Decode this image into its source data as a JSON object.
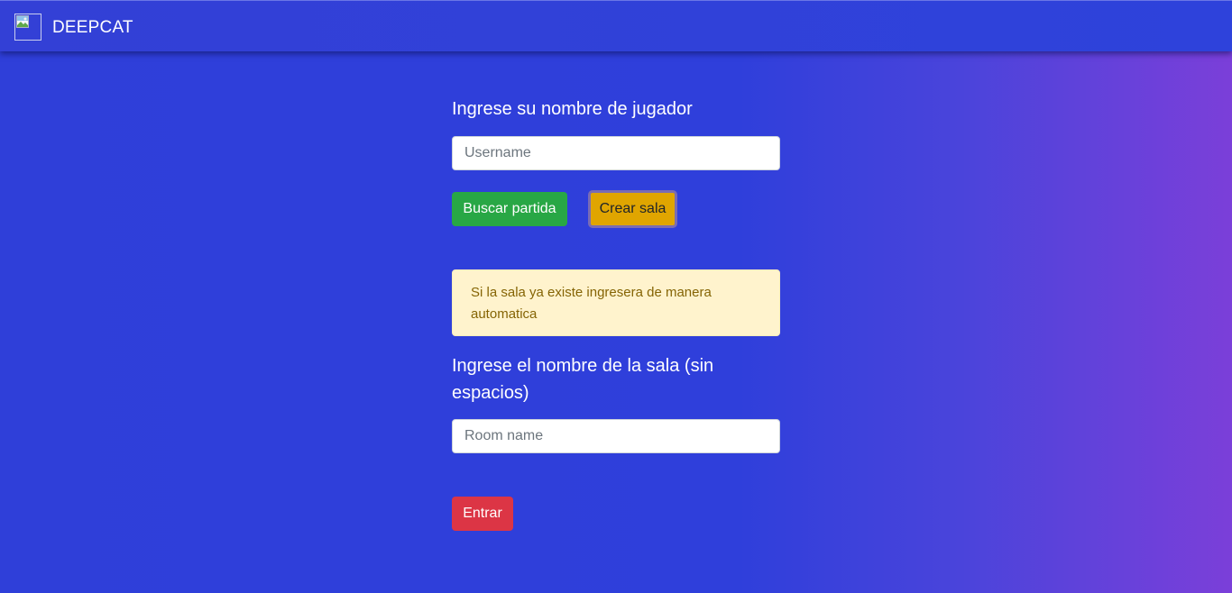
{
  "navbar": {
    "brand": "DEEPCAT",
    "logo_icon": "broken-image-icon"
  },
  "player": {
    "heading": "Ingrese su nombre de jugador",
    "username_placeholder": "Username",
    "username_value": ""
  },
  "actions": {
    "search_label": "Buscar partida",
    "create_label": "Crear sala"
  },
  "notice": {
    "text": "Si la sala ya existe ingresera de manera automatica"
  },
  "room": {
    "heading_line1": "Ingrese el nombre de la sala (sin",
    "heading_line2": "espacios)",
    "room_placeholder": "Room name",
    "room_value": "",
    "enter_label": "Entrar"
  },
  "colors": {
    "background": "#2f3fd9",
    "gradient_end": "#7b3fd9",
    "search_button": "#28a745",
    "create_button": "#e0a500",
    "enter_button": "#dc3545",
    "alert_bg": "#fff3cd",
    "alert_text": "#856404"
  }
}
